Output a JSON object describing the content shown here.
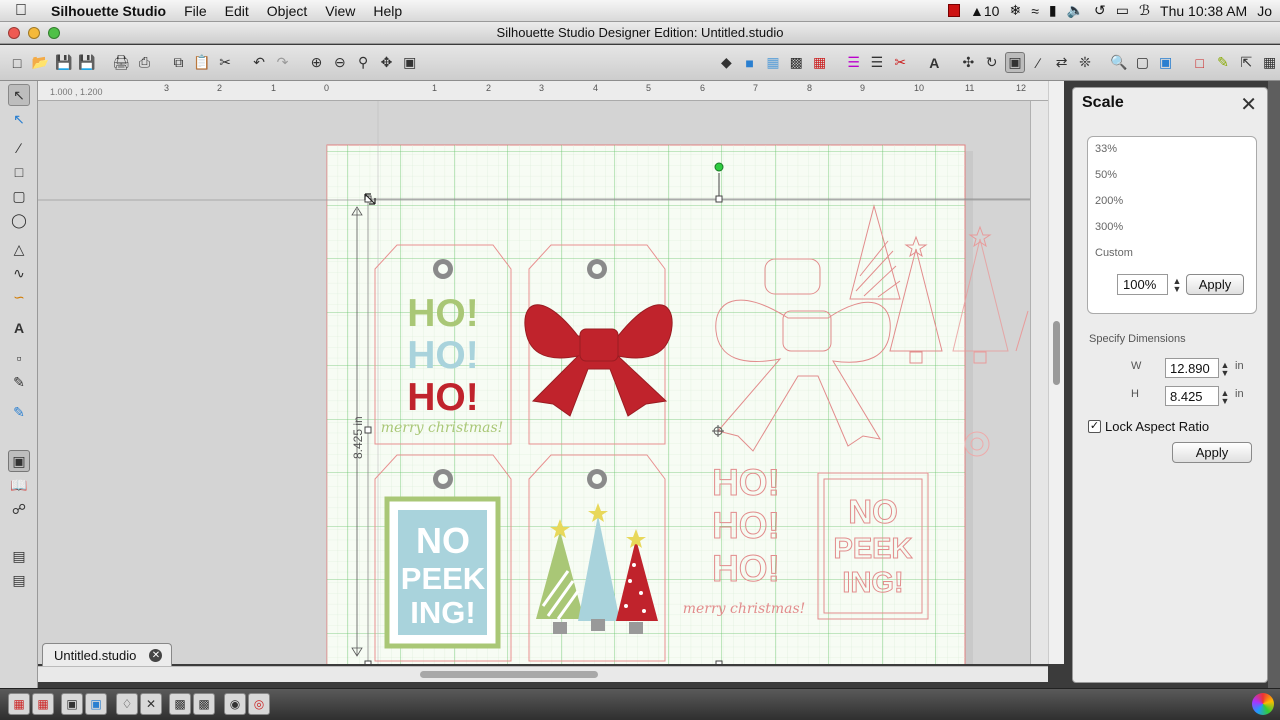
{
  "menubar": {
    "app_name": "Silhouette Studio",
    "items": [
      "File",
      "Edit",
      "Object",
      "View",
      "Help"
    ],
    "status_number": "10",
    "clock": "Thu 10:38 AM",
    "user_initial": "Jo"
  },
  "window": {
    "title": "Silhouette Studio Designer Edition: Untitled.studio"
  },
  "ruler": {
    "coordinates": "1.000 , 1.200",
    "ticks": [
      "3",
      "2",
      "1",
      "0",
      "1",
      "2",
      "3",
      "4",
      "5",
      "6",
      "7",
      "8",
      "9",
      "10",
      "11",
      "12"
    ]
  },
  "canvas": {
    "dimension_label": "8.425 in",
    "tag1": {
      "line1": "HO!",
      "line2": "HO!",
      "line3": "HO!",
      "script": "merry christmas!"
    },
    "tag4": {
      "text": [
        "NO",
        "PEEK",
        "ING!"
      ]
    },
    "outline_ho": {
      "line1": "HO!",
      "line2": "HO!",
      "line3": "HO!",
      "script": "merry christmas!"
    },
    "outline_nopeek": {
      "text": [
        "NO",
        "PEEK",
        "ING!"
      ]
    },
    "colors": {
      "green": "#a9c776",
      "blue": "#a9d3dc",
      "red": "#c0232c",
      "outline": "#e28c8c"
    }
  },
  "doc_tab": {
    "label": "Untitled.studio"
  },
  "panel": {
    "title": "Scale",
    "presets": [
      "33%",
      "50%",
      "200%",
      "300%",
      "Custom"
    ],
    "percent_value": "100%",
    "apply_label": "Apply",
    "dimensions_heading": "Specify Dimensions",
    "w_label": "W",
    "w_value": "12.890",
    "h_label": "H",
    "h_value": "8.425",
    "unit": "in",
    "lock_label": "Lock Aspect Ratio",
    "lock_checked": true,
    "apply2_label": "Apply"
  }
}
